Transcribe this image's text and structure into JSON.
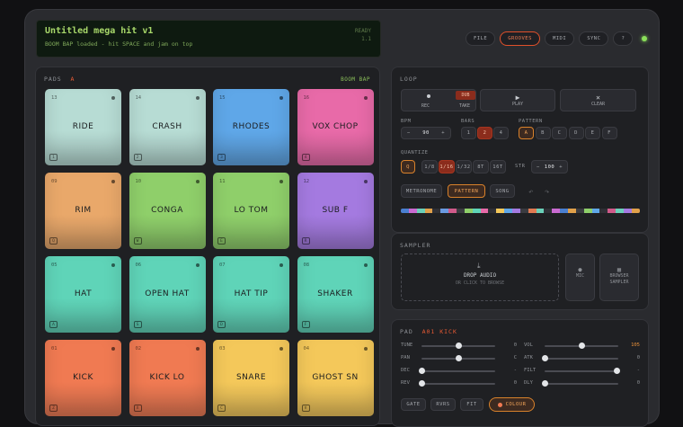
{
  "lcd": {
    "title": "Untitled mega hit v1",
    "subtitle": "BOOM BAP loaded - hit SPACE and jam on top",
    "status": "READY",
    "version": "1.1"
  },
  "topbar": [
    {
      "label": "FILE",
      "active": false
    },
    {
      "label": "GROOVES",
      "active": true
    },
    {
      "label": "MIDI",
      "active": false
    },
    {
      "label": "SYNC",
      "active": false
    },
    {
      "label": "?",
      "active": false
    }
  ],
  "pads_panel": {
    "title": "PADS",
    "bank": "A",
    "kit": "BOOM BAP"
  },
  "pads": [
    {
      "num": "13",
      "name": "RIDE",
      "key": "1",
      "color": "#b7dcd4"
    },
    {
      "num": "14",
      "name": "CRASH",
      "key": "2",
      "color": "#b7dcd4"
    },
    {
      "num": "15",
      "name": "RHODES",
      "key": "3",
      "color": "#5fa7e8"
    },
    {
      "num": "16",
      "name": "VOX CHOP",
      "key": "4",
      "color": "#e86aa8"
    },
    {
      "num": "09",
      "name": "RIM",
      "key": "Q",
      "color": "#e9a86a"
    },
    {
      "num": "10",
      "name": "CONGA",
      "key": "W",
      "color": "#8fcf6a"
    },
    {
      "num": "11",
      "name": "LO TOM",
      "key": "E",
      "color": "#8fcf6a"
    },
    {
      "num": "12",
      "name": "SUB F",
      "key": "R",
      "color": "#a47ae0"
    },
    {
      "num": "05",
      "name": "HAT",
      "key": "A",
      "color": "#5fd4b8"
    },
    {
      "num": "06",
      "name": "OPEN HAT",
      "key": "S",
      "color": "#5fd4b8"
    },
    {
      "num": "07",
      "name": "HAT TIP",
      "key": "D",
      "color": "#5fd4b8"
    },
    {
      "num": "08",
      "name": "SHAKER",
      "key": "F",
      "color": "#5fd4b8"
    },
    {
      "num": "01",
      "name": "KICK",
      "key": "Z",
      "color": "#f07a52"
    },
    {
      "num": "02",
      "name": "KICK LO",
      "key": "X",
      "color": "#f07a52"
    },
    {
      "num": "03",
      "name": "SNARE",
      "key": "C",
      "color": "#f4c85a"
    },
    {
      "num": "04",
      "name": "GHOST SN",
      "key": "V",
      "color": "#f4c85a"
    }
  ],
  "loop": {
    "title": "LOOP",
    "rec": "REC",
    "dub": "DUB",
    "take": "TAKE",
    "play": "PLAY",
    "clear": "CLEAR",
    "bpm_label": "BPM",
    "bpm": "90",
    "minus": "−",
    "plus": "+",
    "bars_label": "BARS",
    "bars": [
      "1",
      "2",
      "4"
    ],
    "bars_active": "2",
    "pattern_label": "PATTERN",
    "patterns": [
      "A",
      "B",
      "C",
      "D",
      "E",
      "F"
    ],
    "pattern_active": "A",
    "quantize_label": "QUANTIZE",
    "q": "Q",
    "quant": [
      "1/8",
      "1/16",
      "1/32",
      "8T",
      "16T"
    ],
    "quant_active": "1/16",
    "str_label": "STR",
    "str": "100",
    "modes": [
      "METRONOME",
      "PATTERN",
      "SONG"
    ],
    "mode_active": "PATTERN",
    "undo_icon": "↶",
    "redo_icon": "↷"
  },
  "sampler": {
    "title": "SAMPLER",
    "drop": "DROP AUDIO",
    "drop_hint": "OR CLICK TO BROWSE",
    "mic": "MIC",
    "browser_1": "BROWSER",
    "browser_2": "SAMPLER"
  },
  "pad_edit": {
    "title": "PAD",
    "pad_id": "A01 KICK",
    "left": [
      {
        "label": "TUNE",
        "value": "0",
        "level": 0.5
      },
      {
        "label": "PAN",
        "value": "C",
        "level": 0.5
      },
      {
        "label": "DEC",
        "value": "-",
        "level": 0.0
      },
      {
        "label": "REV",
        "value": "0",
        "level": 0.0
      }
    ],
    "right": [
      {
        "label": "VOL",
        "value": "105",
        "level": 0.5,
        "hot": true
      },
      {
        "label": "ATK",
        "value": "0",
        "level": 0.0
      },
      {
        "label": "FILT",
        "value": "-",
        "level": 0.98
      },
      {
        "label": "DLY",
        "value": "0",
        "level": 0.0
      }
    ],
    "buttons": [
      "GATE",
      "RVRS",
      "FIT"
    ],
    "colour": "COLOUR"
  }
}
